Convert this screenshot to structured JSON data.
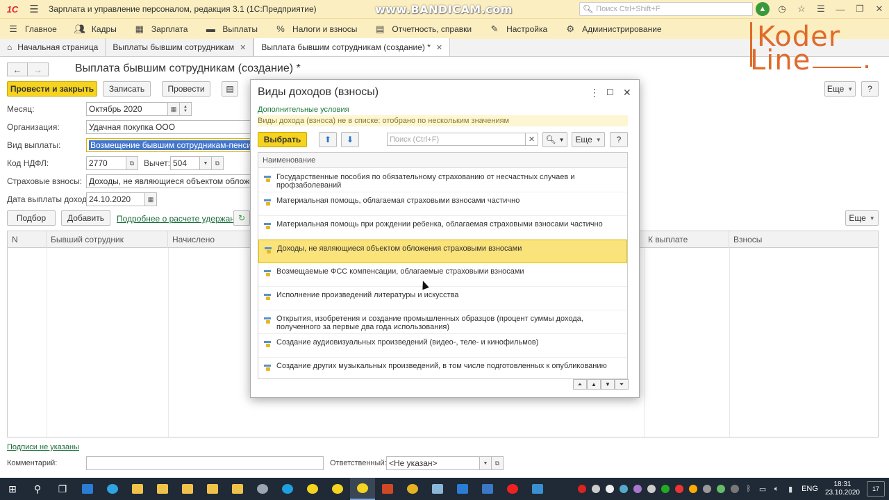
{
  "window": {
    "title": "Зарплата и управление персоналом, редакция 3.1  (1С:Предприятие)",
    "watermark": "www.BANDICAM.com",
    "search_placeholder": "Поиск Ctrl+Shift+F",
    "logo": "1С"
  },
  "main_menu": [
    {
      "label": "Главное",
      "icon": "menu-icon"
    },
    {
      "label": "Кадры",
      "icon": "people-icon"
    },
    {
      "label": "Зарплата",
      "icon": "calculator-icon"
    },
    {
      "label": "Выплаты",
      "icon": "wallet-icon"
    },
    {
      "label": "Налоги и взносы",
      "icon": "percent-icon"
    },
    {
      "label": "Отчетность, справки",
      "icon": "report-icon"
    },
    {
      "label": "Настройка",
      "icon": "wrench-icon"
    },
    {
      "label": "Администрирование",
      "icon": "gear-icon"
    }
  ],
  "tabs": [
    {
      "label": "Начальная страница"
    },
    {
      "label": "Выплаты бывшим сотрудникам"
    },
    {
      "label": "Выплата бывшим сотрудникам (создание) *"
    }
  ],
  "brand": {
    "line1": "Koder",
    "line2": "Line"
  },
  "document": {
    "title": "Выплата бывшим сотрудникам (создание) *",
    "buttons": {
      "post_close": "Провести и закрыть",
      "save": "Записать",
      "post": "Провести",
      "more": "Еще",
      "help": "?"
    },
    "fields": {
      "month_label": "Месяц:",
      "month_value": "Октябрь 2020",
      "org_label": "Организация:",
      "org_value": "Удачная покупка ООО",
      "payment_type_label": "Вид выплаты:",
      "payment_type_value": "Возмещение бывшим сотрудникам-пенсионерам",
      "ndfl_label": "Код НДФЛ:",
      "ndfl_value": "2770",
      "deduction_label": "Вычет:",
      "deduction_value": "504",
      "contrib_label": "Страховые взносы:",
      "contrib_value": "Доходы, не являющиеся объектом обложения ст",
      "date_label": "Дата выплаты дохода:",
      "date_value": "24.10.2020"
    },
    "table_buttons": {
      "pick": "Подбор",
      "add": "Добавить",
      "details_link": "Подробнее о расчете удержаний",
      "more": "Еще"
    },
    "table_columns": {
      "n": "N",
      "employee": "Бывший сотрудник",
      "accrued": "Начислено",
      "to_pay": "К выплате",
      "contributions": "Взносы"
    },
    "signatures_link": "Подписи не указаны",
    "comment_label": "Комментарий:",
    "responsible_label": "Ответственный:",
    "responsible_value": "<Не указан>"
  },
  "dialog": {
    "title": "Виды доходов (взносы)",
    "conditions_link": "Дополнительные условия",
    "conditions_text": "Виды дохода (взноса) не в списке: отобрано по нескольким значениям",
    "select_button": "Выбрать",
    "search_placeholder": "Поиск (Ctrl+F)",
    "more_button": "Еще",
    "help_button": "?",
    "column_header": "Наименование",
    "rows": [
      {
        "text": "Государственные пособия по обязательному страхованию от несчастных случаев и профзаболеваний"
      },
      {
        "text": "Материальная помощь, облагаемая страховыми взносами частично"
      },
      {
        "text": "Материальная помощь при рождении ребенка, облагаемая страховыми взносами частично"
      },
      {
        "text": "Доходы, не являющиеся объектом обложения страховыми взносами",
        "selected": true
      },
      {
        "text": "Возмещаемые ФСС компенсации, облагаемые страховыми взносами"
      },
      {
        "text": "Исполнение произведений литературы и искусства"
      },
      {
        "text": "Открытия, изобретения и создание промышленных образцов (процент суммы дохода, полученного за первые два года использования)"
      },
      {
        "text": "Создание аудиовизуальных произведений (видео-, теле- и кинофильмов)"
      },
      {
        "text": "Создание других музыкальных произведений, в том числе подготовленных к опубликованию"
      }
    ]
  },
  "taskbar": {
    "lang": "ENG",
    "time": "18:31",
    "date": "23.10.2020",
    "notifications": "17"
  },
  "colors": {
    "accent_yellow": "#f5d31e",
    "menu_bg": "#fbeec0",
    "selected_row": "#fbe37c",
    "link_green": "#1a6b3a",
    "brand_orange": "#e06a2a"
  }
}
